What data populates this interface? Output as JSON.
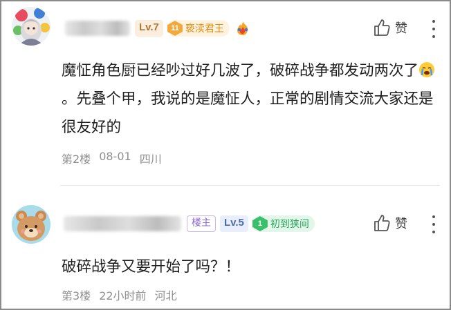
{
  "comments": [
    {
      "floor": "第2楼",
      "time": "08-01",
      "location": "四川",
      "level": "Lv.7",
      "title_badge": {
        "number": "11",
        "text": "亵渎君王",
        "color": "#e38b12"
      },
      "like_label": "赞",
      "content_parts": [
        "魔怔角色厨已经吵过好几波了，破碎战争都发动两次了",
        "。先叠个甲，我说的是魔怔人，正常的剧情交流大家还是很友好的"
      ],
      "avatar_icon": "anime-character-avatar",
      "extra_icon": "fire-badge-icon"
    },
    {
      "floor": "第3楼",
      "time": "22小时前",
      "location": "河北",
      "owner_badge": "楼主",
      "level": "Lv.5",
      "title_badge": {
        "number": "1",
        "text": "初到狭间",
        "color": "#26a35a"
      },
      "like_label": "赞",
      "content": "破碎战争又要开始了吗？！",
      "avatar_icon": "bear-avatar"
    }
  ]
}
